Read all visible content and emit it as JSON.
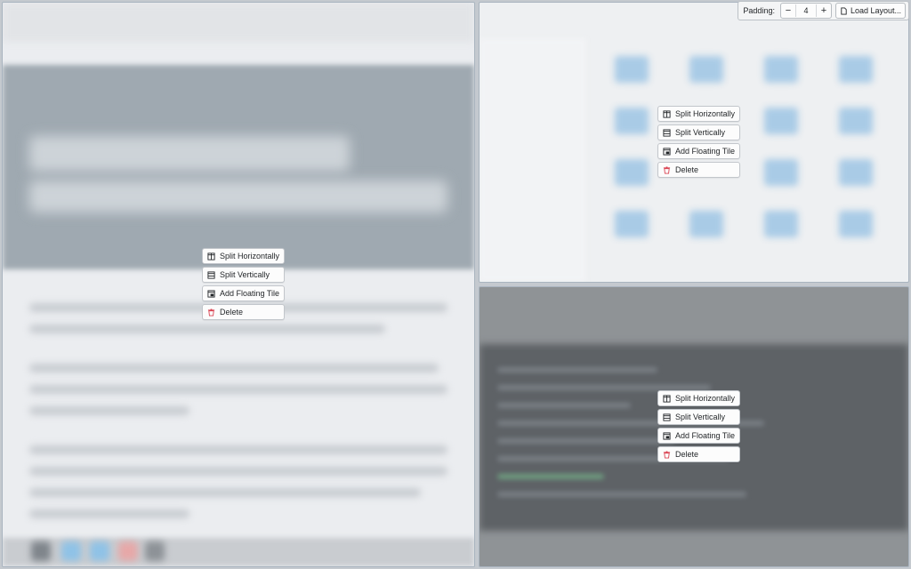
{
  "toolbar": {
    "padding_label": "Padding:",
    "decrement_label": "−",
    "padding_value": "4",
    "increment_label": "+",
    "load_layout_label": "Load Layout..."
  },
  "tile_menus": {
    "left": {
      "split_horizontally": "Split Horizontally",
      "split_vertically": "Split Vertically",
      "add_floating_tile": "Add Floating Tile",
      "delete": "Delete"
    },
    "top_right": {
      "split_horizontally": "Split Horizontally",
      "split_vertically": "Split Vertically",
      "add_floating_tile": "Add Floating Tile",
      "delete": "Delete"
    },
    "bottom_right": {
      "split_horizontally": "Split Horizontally",
      "split_vertically": "Split Vertically",
      "add_floating_tile": "Add Floating Tile",
      "delete": "Delete"
    }
  },
  "colors": {
    "accent": "#3daee9",
    "delete_icon": "#da4453",
    "tile_border": "#a9b4bf"
  }
}
